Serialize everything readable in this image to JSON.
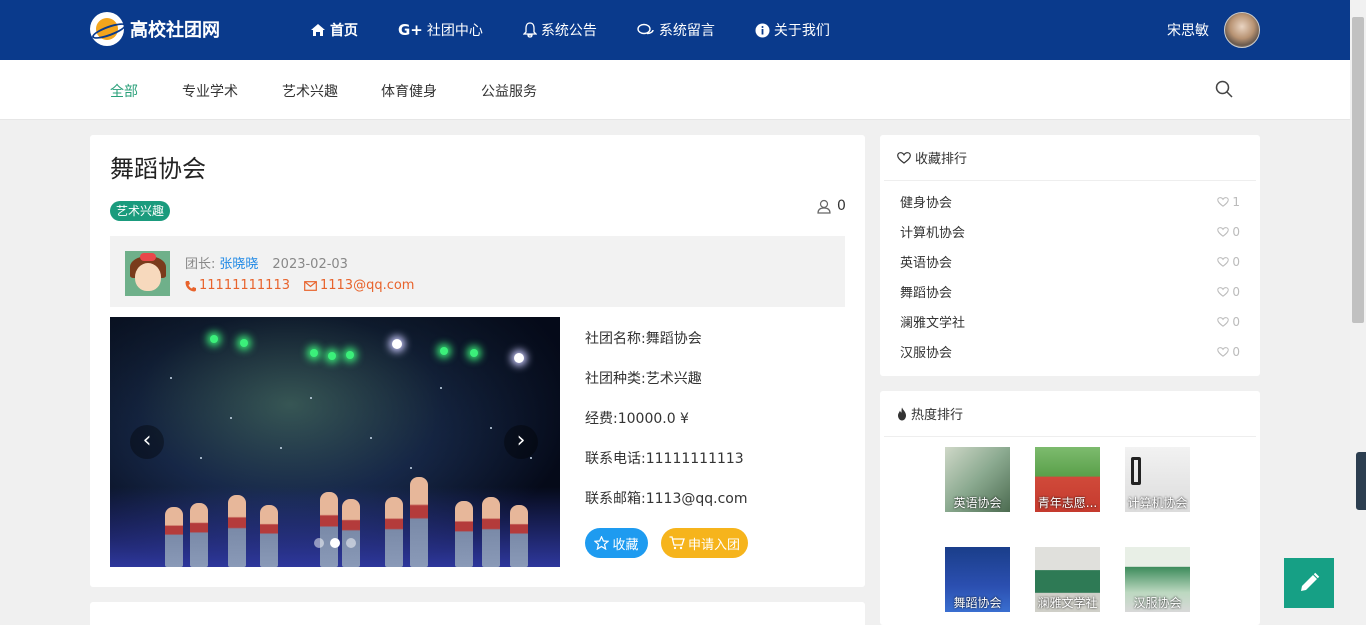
{
  "header": {
    "site_name": "高校社团网",
    "nav": [
      {
        "label": "首页",
        "icon": "home-icon"
      },
      {
        "label": "社团中心",
        "icon": "google-plus-icon"
      },
      {
        "label": "系统公告",
        "icon": "bell-icon"
      },
      {
        "label": "系统留言",
        "icon": "comments-icon"
      },
      {
        "label": "关于我们",
        "icon": "info-icon"
      }
    ],
    "user_name": "宋思敏"
  },
  "categories": [
    "全部",
    "专业学术",
    "艺术兴趣",
    "体育健身",
    "公益服务"
  ],
  "club": {
    "title": "舞蹈协会",
    "tag": "艺术兴趣",
    "member_count": "0",
    "leader_label": "团长:",
    "leader_name": "张晓晓",
    "date": "2023-02-03",
    "phone": "11111111113",
    "email": "1113@qq.com",
    "info": [
      "社团名称:舞蹈协会",
      "社团种类:艺术兴趣",
      "经费:10000.0 ¥",
      "联系电话:11111111113",
      "联系邮箱:1113@qq.com"
    ],
    "fav_label": "收藏",
    "apply_label": "申请入团"
  },
  "fav_rank": {
    "title": "收藏排行",
    "items": [
      {
        "name": "健身协会",
        "count": "1"
      },
      {
        "name": "计算机协会",
        "count": "0"
      },
      {
        "name": "英语协会",
        "count": "0"
      },
      {
        "name": "舞蹈协会",
        "count": "0"
      },
      {
        "name": "澜雅文学社",
        "count": "0"
      },
      {
        "name": "汉服协会",
        "count": "0"
      }
    ]
  },
  "hot_rank": {
    "title": "热度排行",
    "items": [
      {
        "label": "英语协会"
      },
      {
        "label": "青年志愿..."
      },
      {
        "label": "计算机协会"
      },
      {
        "label": "舞蹈协会"
      },
      {
        "label": "澜雅文学社"
      },
      {
        "label": "汉服协会"
      }
    ]
  }
}
